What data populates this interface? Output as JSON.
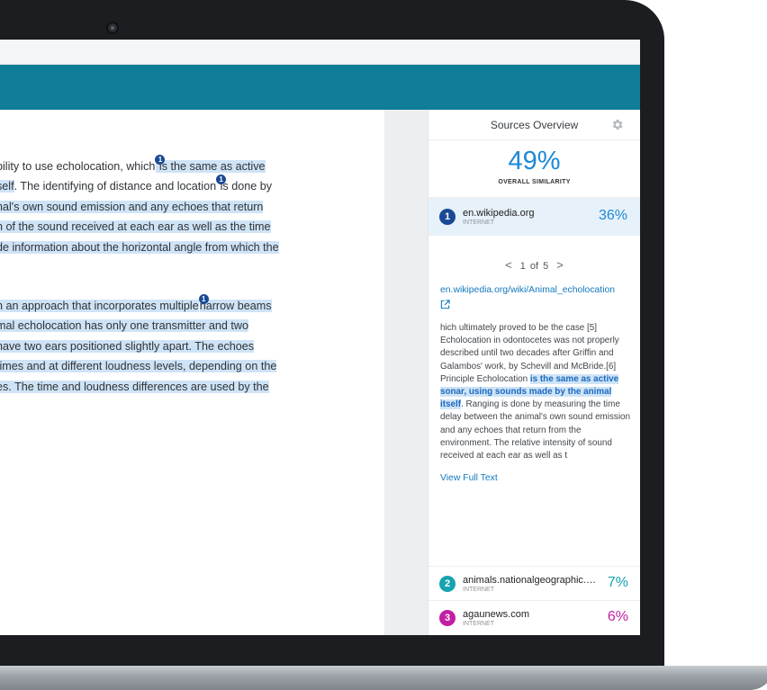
{
  "document": {
    "para1": {
      "lines": [
        {
          "pre": "bility to use echolocation, which",
          "pin": "1",
          "hl": " is the same as active"
        },
        {
          "hl": "self",
          "post": ". The identifying of distance and location",
          "pin": "1",
          "post2": " is done by"
        },
        {
          "hl": "nal's own sound emission and any echoes that return"
        },
        {
          "hl": "n of the sound received at each ear as well as the time"
        },
        {
          "hl": "de information about the horizontal angle from which the"
        }
      ]
    },
    "para2": {
      "lines": [
        {
          "hl": "n an approach that incorporates multiple",
          "pin": "1",
          "post": "narrow beams"
        },
        {
          "hl": "mal echolocation has only one transmitter and two"
        },
        {
          "hl": "have two ears positioned slightly apart. The echoes"
        },
        {
          "hl": " times and at different loudness levels, depending on the"
        },
        {
          "hl": "es. The time and loudness differences are used by the"
        },
        {
          "hl": "."
        }
      ]
    }
  },
  "panel": {
    "title": "Sources Overview",
    "similarity": "49%",
    "similarity_label": "OVERALL SIMILARITY",
    "sources": [
      {
        "num": "1",
        "name": "en.wikipedia.org",
        "type": "INTERNET",
        "pct": "36%",
        "color": "#1e88d4"
      },
      {
        "num": "2",
        "name": "animals.nationalgeographic.c...",
        "type": "INTERNET",
        "pct": "7%",
        "color": "#16a3b0"
      },
      {
        "num": "3",
        "name": "agaunews.com",
        "type": "INTERNET",
        "pct": "6%",
        "color": "#c21fa4"
      }
    ],
    "pager": {
      "prev": "<",
      "label": "1 of 5",
      "next": ">"
    },
    "url": "en.wikipedia.org/wiki/Animal_echolocation",
    "excerpt_pre": "hich ultimately proved to be the case [5] Echolocation in odontocetes was not properly described until two decades after Griffin and Galambos' work, by Schevill and McBride.[6] Principle Echolocation ",
    "excerpt_match": "is the same as active sonar, using sounds made by the animal itself",
    "excerpt_post": ". Ranging is done by measuring the time delay between the animal's own sound emission and any echoes that return from the environment. The relative intensity of sound received at each ear as well as t",
    "view_full_text": "View Full Text",
    "icons": {
      "settings": "gear-icon",
      "external": "external-link-icon"
    }
  }
}
